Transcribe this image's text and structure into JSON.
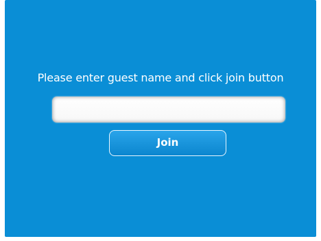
{
  "colors": {
    "background": "#0a8ed6",
    "text": "#ffffff",
    "button_border": "#e9f6ff"
  },
  "guest": {
    "prompt": "Please enter guest name and click join button",
    "name_value": "",
    "join_label": "Join"
  }
}
